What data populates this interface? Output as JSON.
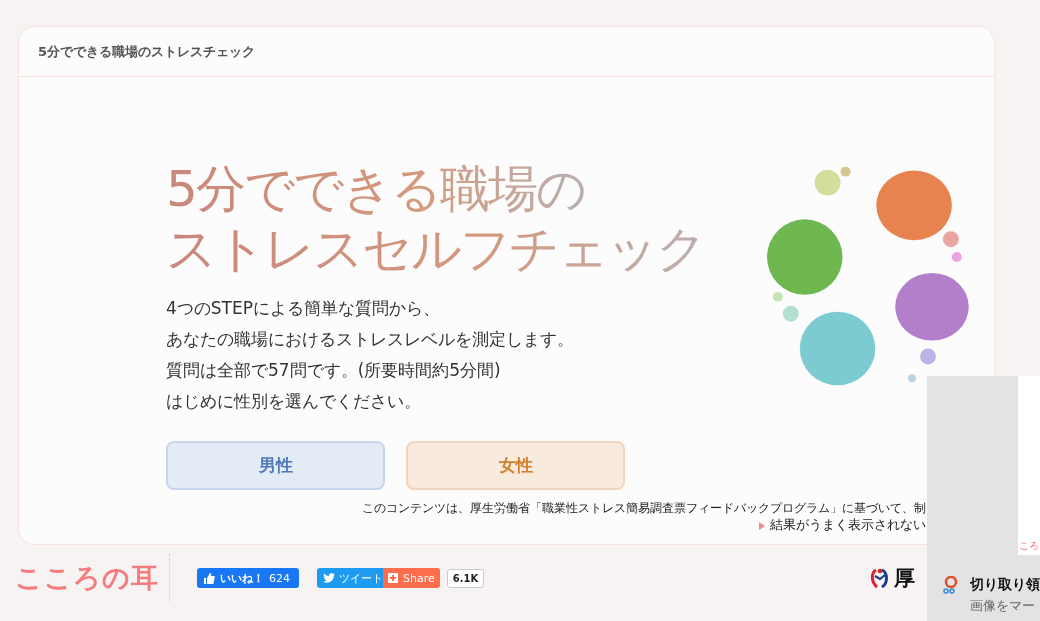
{
  "header": {
    "title": "5分でできる職場のストレスチェック"
  },
  "hero": {
    "title_lines": [
      "5分でできる職場の",
      "ストレスセルフチェック"
    ],
    "intro_lines": [
      "4つのSTEPによる簡単な質問から、",
      "あなたの職場におけるストレスレベルを測定します。",
      "質問は全部で57問です。(所要時間約5分間)",
      "はじめに性別を選んでください。"
    ]
  },
  "gender_buttons": [
    {
      "label": "男性",
      "kind": "male"
    },
    {
      "label": "女性",
      "kind": "female"
    }
  ],
  "note": "このコンテンツは、厚生労働省「職業性ストレス簡易調査票フィードバックプログラム」に基づいて、制",
  "help_link": "結果がうまく表示されない",
  "footer": {
    "logo": "こころの耳",
    "like": {
      "label": "いいね！",
      "count": "624"
    },
    "tweet": "ツイート",
    "share": {
      "label": "Share",
      "count": "6.1K"
    },
    "ministry": "厚"
  },
  "notification": {
    "thumbnail_text": "ころ",
    "title": "切り取り領",
    "body": "画像をマー"
  }
}
